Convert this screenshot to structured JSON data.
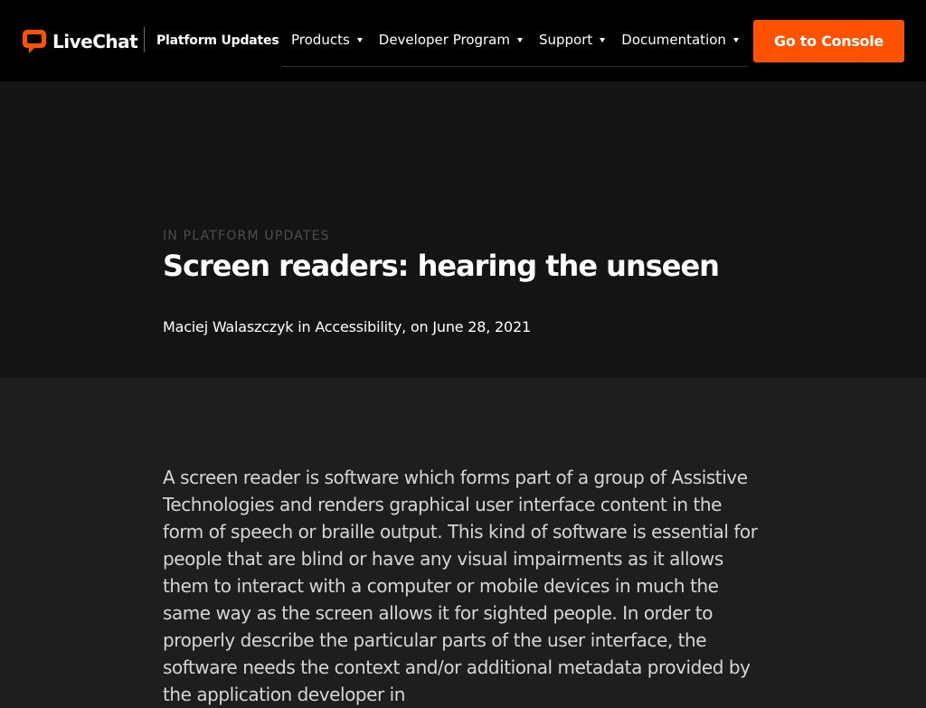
{
  "header": {
    "brand": "LiveChat",
    "section": "Platform Updates",
    "nav": [
      {
        "label": "Products"
      },
      {
        "label": "Developer Program"
      },
      {
        "label": "Support"
      },
      {
        "label": "Documentation"
      }
    ],
    "cta_label": "Go to Console",
    "accent_color": "#ff5100"
  },
  "post": {
    "category": "IN PLATFORM UPDATES",
    "title": "Screen readers: hearing the unseen",
    "author": "Maciej Walaszczyk",
    "in_word": "in",
    "topic": "Accessibility",
    "date_prefix": ", on",
    "date": "June 28, 2021",
    "body": "A screen reader is software which forms part of a group of Assistive Technologies and renders graphical user interface content in the form of speech or braille output. This kind of software is essential for people that are blind or have any visual impairments as it allows them to interact with a computer or mobile devices in much the same way as the screen allows it for sighted people. In order to properly describe the particular parts of the user interface, the software needs the context and/or additional metadata provided by the application developer in"
  },
  "icons": {
    "logo": "chat-bubble-icon",
    "nav_caret": "caret-down-icon"
  }
}
